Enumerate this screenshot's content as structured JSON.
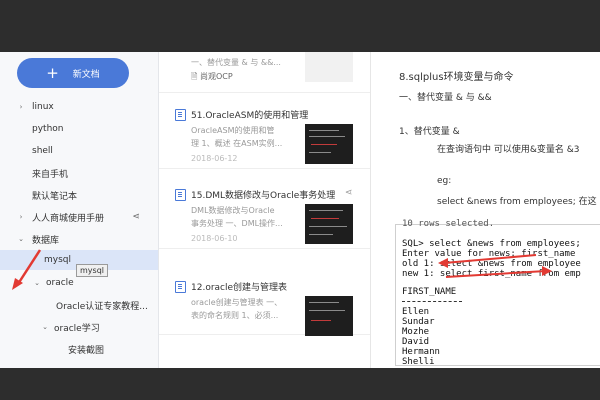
{
  "sidebar": {
    "new_button": "新文档",
    "items": [
      {
        "label": "linux",
        "arrow": "›"
      },
      {
        "label": "python",
        "arrow": ""
      },
      {
        "label": "shell",
        "arrow": ""
      },
      {
        "label": "来自手机",
        "arrow": ""
      },
      {
        "label": "默认笔记本",
        "arrow": ""
      },
      {
        "label": "人人商城使用手册",
        "arrow": "›"
      },
      {
        "label": "数据库",
        "arrow": "⌄"
      },
      {
        "label": "mysql",
        "arrow": ""
      },
      {
        "label": "oracle",
        "arrow": "⌄"
      },
      {
        "label": "Oracle认证专家教程...",
        "arrow": ""
      },
      {
        "label": "oracle学习",
        "arrow": "⌄"
      },
      {
        "label": "安装截图",
        "arrow": ""
      }
    ],
    "tooltip": "mysql",
    "accent": "#4a79d8",
    "arrow_color": "#e23a33"
  },
  "list": {
    "top_card": {
      "desc": "一、替代变量 & 与 &&...",
      "sub": "🗎 尚观OCP"
    },
    "cards": [
      {
        "title": "51.OracleASM的使用和管理",
        "desc1": "OracleASM的使用和管",
        "desc2": "理 1、概述 在ASM实例...",
        "date": "2018-06-12"
      },
      {
        "title": "15.DML数据修改与Oracle事务处理",
        "desc1": "DML数据修改与Oracle",
        "desc2": "事务处理 一、DML操作...",
        "date": "2018-06-10"
      },
      {
        "title": "12.oracle创建与管理表",
        "desc1": "oracle创建与管理表 一、",
        "desc2": "表的命名规则 1、必须...",
        "date": "2018-06-10"
      }
    ]
  },
  "document": {
    "heading": "8.sqlplus环境变量与命令",
    "sub1": "一、替代变量  &    与  &&",
    "point1": "1、替代变量  &",
    "line1": "在查询语句中  可以使用&变量名  &3",
    "eg": "eg:",
    "sql": "select &news from employees;   在这",
    "terminal": [
      "10 rows selected.",
      "SQL> select &news from employees;",
      "Enter value for news: first_name",
      "old   1: select &news from employee",
      "new   1: select first_name from emp",
      "FIRST_NAME",
      "Ellen",
      "Sundar",
      "Mozhe",
      "David",
      "Hermann",
      "Shelli"
    ]
  }
}
